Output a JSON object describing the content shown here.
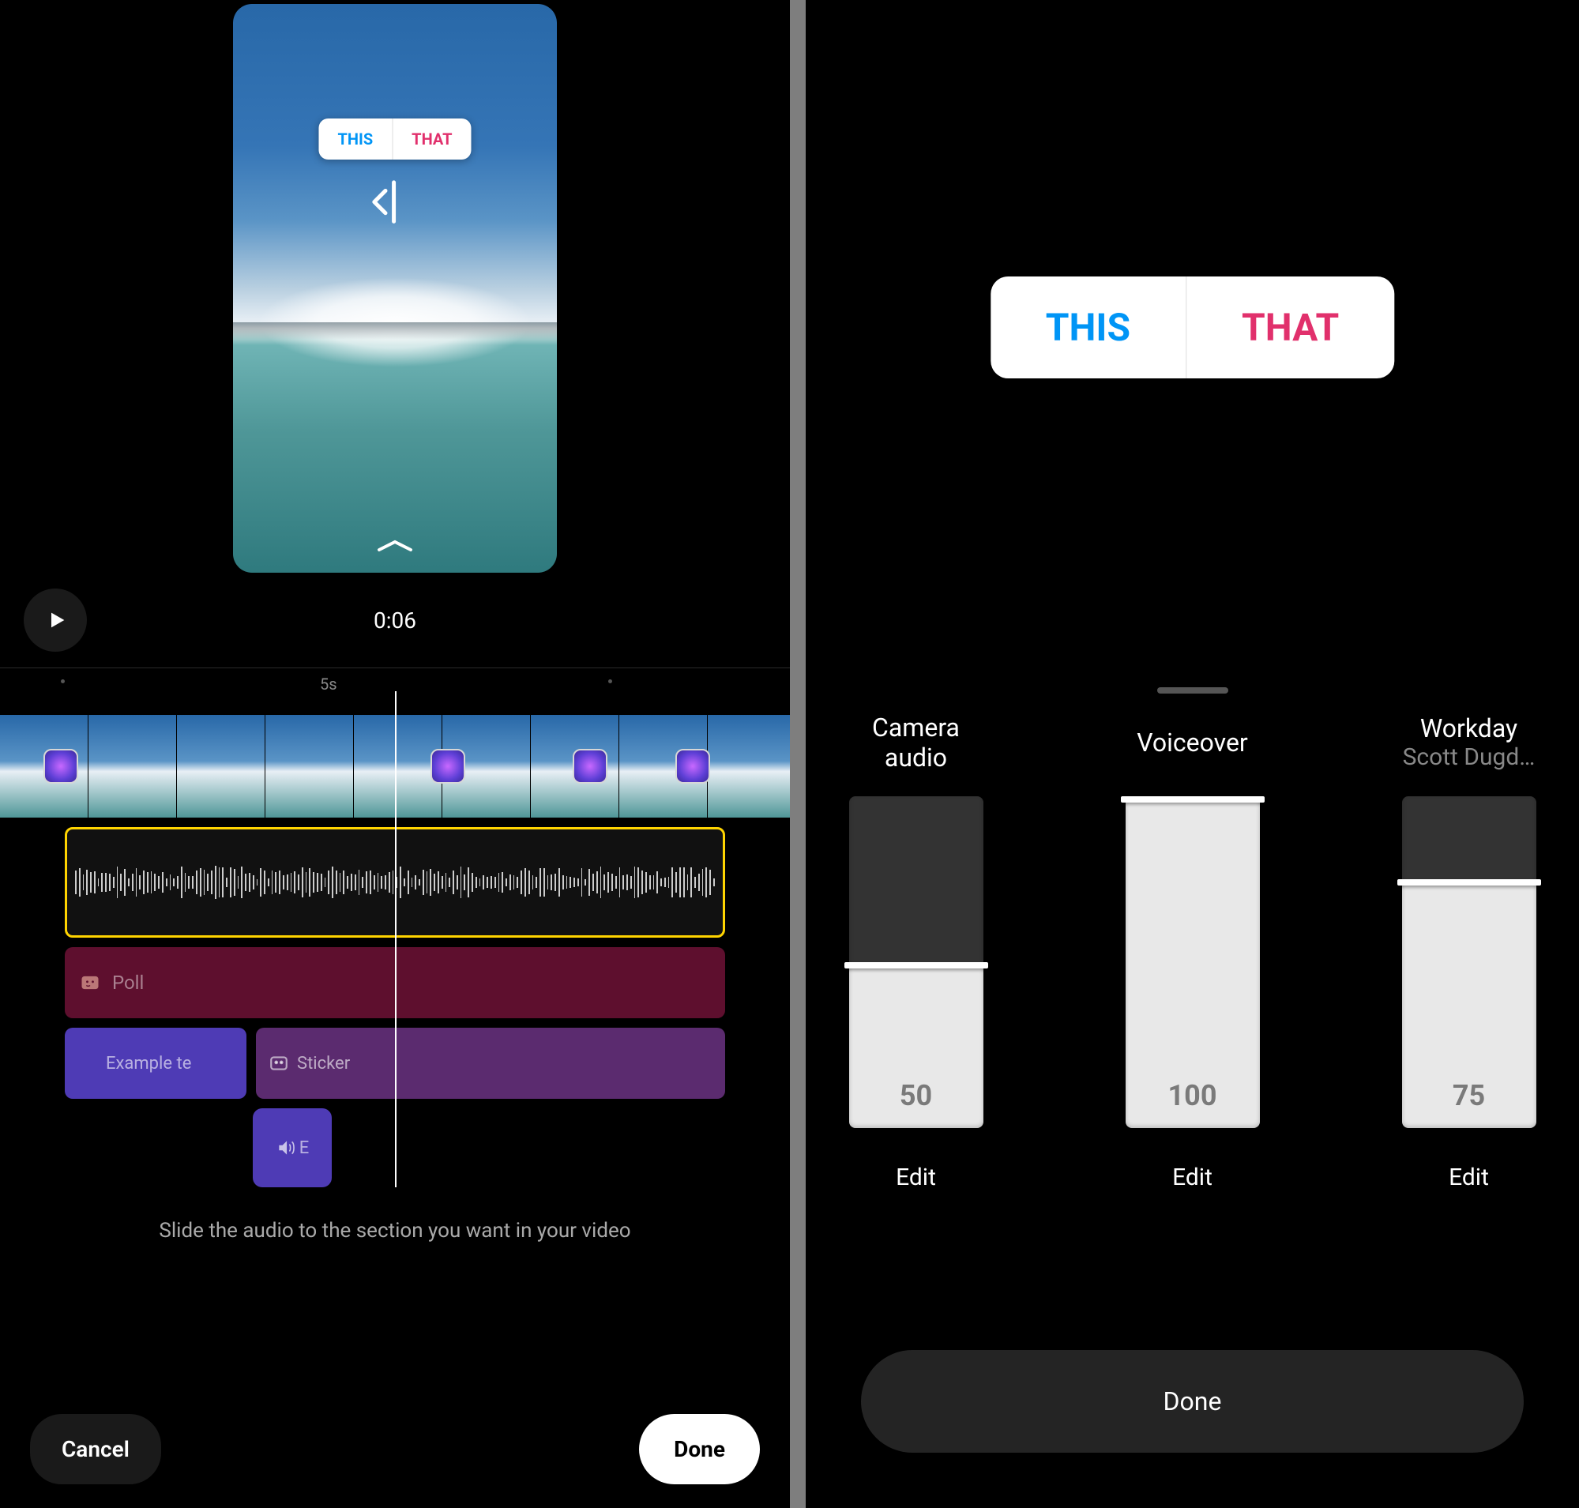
{
  "left": {
    "poll": {
      "option1": "THIS",
      "option2": "THAT"
    },
    "timecode": "0:06",
    "timeMarker": "5s",
    "tracks": {
      "poll_label": "Poll",
      "text_label": "Example te",
      "sticker_label": "Sticker",
      "small_label": "E"
    },
    "hint": "Slide the audio to the section you want in your video",
    "cancel": "Cancel",
    "done": "Done"
  },
  "right": {
    "poll": {
      "option1": "THIS",
      "option2": "THAT"
    },
    "mixers": [
      {
        "title": "Camera audio",
        "subtitle": "",
        "value": "50",
        "fill": 50,
        "edit": "Edit"
      },
      {
        "title": "Voiceover",
        "subtitle": "",
        "value": "100",
        "fill": 100,
        "edit": "Edit"
      },
      {
        "title": "Workday",
        "subtitle": "Scott Dugd…",
        "value": "75",
        "fill": 75,
        "edit": "Edit"
      }
    ],
    "done": "Done"
  }
}
